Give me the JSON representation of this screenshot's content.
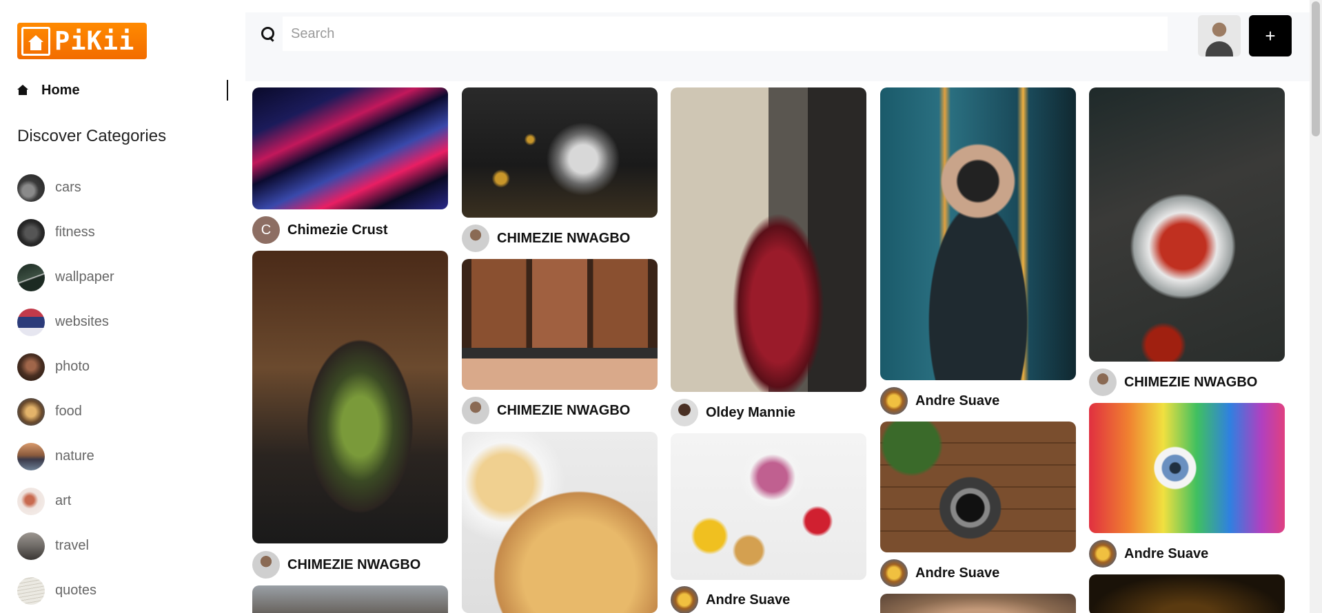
{
  "app": {
    "logo_text": "PiKii"
  },
  "sidebar": {
    "home_label": "Home",
    "categories_heading": "Discover Categories",
    "categories": [
      {
        "label": "cars",
        "icon": "car-thumb",
        "color": "#3b3b3b"
      },
      {
        "label": "fitness",
        "icon": "fitness-thumb",
        "color": "#2a2a2a"
      },
      {
        "label": "wallpaper",
        "icon": "wallpaper-thumb",
        "color": "#2f3b33"
      },
      {
        "label": "websites",
        "icon": "websites-thumb",
        "color": "#2b3b7a"
      },
      {
        "label": "photo",
        "icon": "photo-thumb",
        "color": "#4a2f22"
      },
      {
        "label": "food",
        "icon": "food-thumb",
        "color": "#6b4a2b"
      },
      {
        "label": "nature",
        "icon": "nature-thumb",
        "color": "#8a5a3c"
      },
      {
        "label": "art",
        "icon": "art-thumb",
        "color": "#c86a4f"
      },
      {
        "label": "travel",
        "icon": "travel-thumb",
        "color": "#6e6a66"
      },
      {
        "label": "quotes",
        "icon": "quotes-thumb",
        "color": "#d8d6cf"
      }
    ]
  },
  "search": {
    "placeholder": "Search",
    "value": ""
  },
  "header": {
    "add_label": "+"
  },
  "pins": [
    {
      "author": "Chimezie Crust",
      "avatar_initial": "C"
    },
    {
      "author": "CHIMEZIE NWAGBO"
    },
    {
      "author": "CHIMEZIE NWAGBO"
    },
    {
      "author": "CHIMEZIE NWAGBO"
    },
    {
      "author": "Oldey Mannie"
    },
    {
      "author": "Andre Suave"
    },
    {
      "author": "Andre Suave"
    },
    {
      "author": "CHIMEZIE NWAGBO"
    },
    {
      "author": "Andre Suave"
    },
    {
      "author": "Andre Suave"
    }
  ]
}
